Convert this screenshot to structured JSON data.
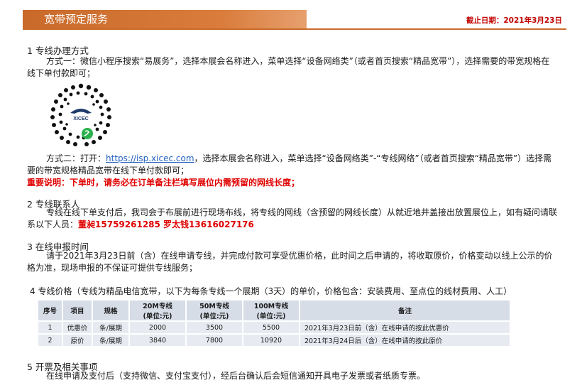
{
  "header": {
    "title": "宽带预定服务",
    "deadline": "截止日期：2021年3月23日"
  },
  "section1": {
    "title": "1 专线办理方式",
    "method1": "方式一：微信小程序搜索“易展务”，选择本展会名称进入，菜单选择“设备网络类”（或者首页搜索“精品宽带”），选择需要的带宽规格在线下单付款即可；",
    "qr_brand": "XICEC",
    "method2_prefix": "方式二：打开：",
    "method2_link": "https://isp.xicec.com",
    "method2_suffix": "，选择本展会名称进入，菜单选择“设备网络类”-“专线网络”（或者首页搜索“精品宽带”）选择需要的带宽规格精品宽带在线下单付款即可；",
    "notice": "重要说明：下单时，请务必在订单备注栏填写展位内需预留的网线长度；"
  },
  "section2": {
    "title": "2 专线联系人",
    "text": "专线在线下单支付后，我司会于布展前进行现场布线，将专线的网线（含预留的网线长度）从就近地井盖接出放置展位上，如有疑问请联系以下人员：",
    "contacts": "董昶15759261285 罗太钱13616027176"
  },
  "section3": {
    "title": "3 在线申报时间",
    "text": "请于2021年3月23日前（含）在线申请专线，并完成付款可享受优惠价格，此时间之后申请的，将收取原价，价格变动以线上公示的价格为准，现场申报的不保证可提供专线服务；"
  },
  "section4": {
    "title": "4 专线价格（专线为精品电信宽带，以下为每条专线一个展期（3天）的单价，价格包含：安装费用、至点位的线材费用、人工）",
    "headers": [
      "序号",
      "项目",
      "规格",
      "20M专线",
      "50M专线",
      "100M专线",
      "备注"
    ],
    "unit": "(单位:元)",
    "rows": [
      [
        "1",
        "优惠价",
        "条/展期",
        "2000",
        "3500",
        "5500",
        "2021年3月23日前（含）在线申请的按此优惠价"
      ],
      [
        "2",
        "原价",
        "条/展期",
        "3840",
        "7800",
        "10920",
        "2021年3月24日后（含）在线申请的按此原价"
      ]
    ]
  },
  "section5": {
    "title": "5 开票及相关事项",
    "text": "在线申请及支付后（支持微信、支付宝支付），经后台确认后会短信通知开具电子发票或者纸质专票。"
  },
  "colors": {
    "accent": "#c96a2a",
    "warning": "#e00000",
    "link": "#1f5fbf"
  }
}
